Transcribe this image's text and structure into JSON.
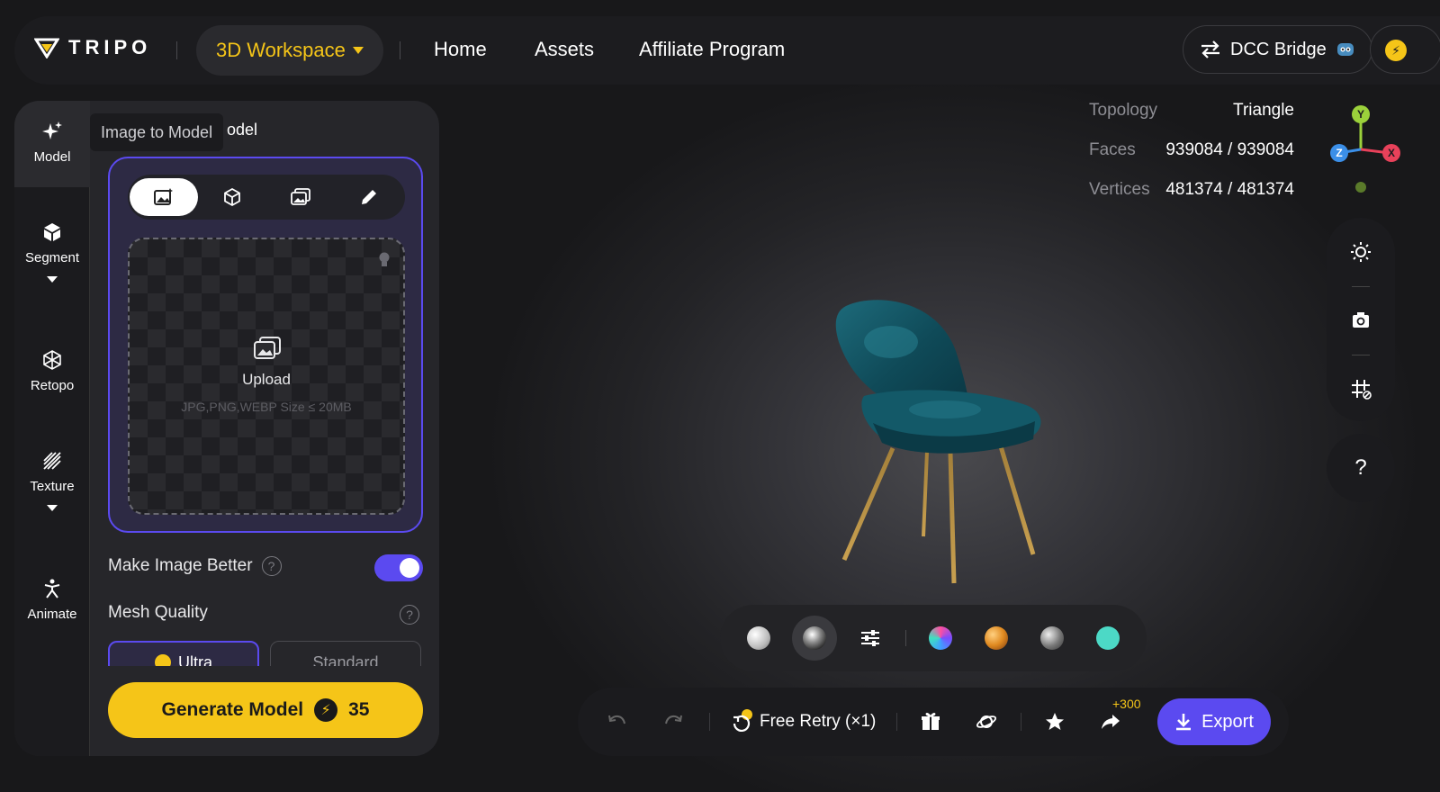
{
  "header": {
    "brand": "TRIPO",
    "workspace_label": "3D Workspace",
    "nav": [
      "Home",
      "Assets",
      "Affiliate Program"
    ],
    "dcc_bridge_label": "DCC Bridge"
  },
  "sidebar": {
    "tools": [
      {
        "label": "Model",
        "icon": "sparkle-icon"
      },
      {
        "label": "Segment",
        "icon": "cube-icon"
      },
      {
        "label": "Retopo",
        "icon": "mesh-icon"
      },
      {
        "label": "Texture",
        "icon": "texture-icon"
      },
      {
        "label": "Animate",
        "icon": "person-icon"
      }
    ]
  },
  "panel": {
    "tooltip": "Image to Model",
    "title_fragment": "odel",
    "upload_label": "Upload",
    "upload_hint": "JPG,PNG,WEBP Size ≤ 20MB",
    "make_image_better_label": "Make Image Better",
    "make_image_better_on": true,
    "mesh_quality_label": "Mesh Quality",
    "quality_options": [
      "Ultra",
      "Standard"
    ],
    "quality_selected": "Ultra",
    "generate_label": "Generate Model",
    "generate_cost": "35"
  },
  "stats": {
    "topology_label": "Topology",
    "topology_value": "Triangle",
    "faces_label": "Faces",
    "faces_value": "939084 / 939084",
    "vertices_label": "Vertices",
    "vertices_value": "481374 / 481374"
  },
  "gizmo": {
    "y": "Y",
    "z": "Z",
    "x": "X"
  },
  "help_label": "?",
  "actions": {
    "free_retry_label": "Free Retry (×1)",
    "share_bonus": "+300",
    "export_label": "Export"
  },
  "colors": {
    "accent": "#5b4af0",
    "brand_yellow": "#f5c518"
  }
}
